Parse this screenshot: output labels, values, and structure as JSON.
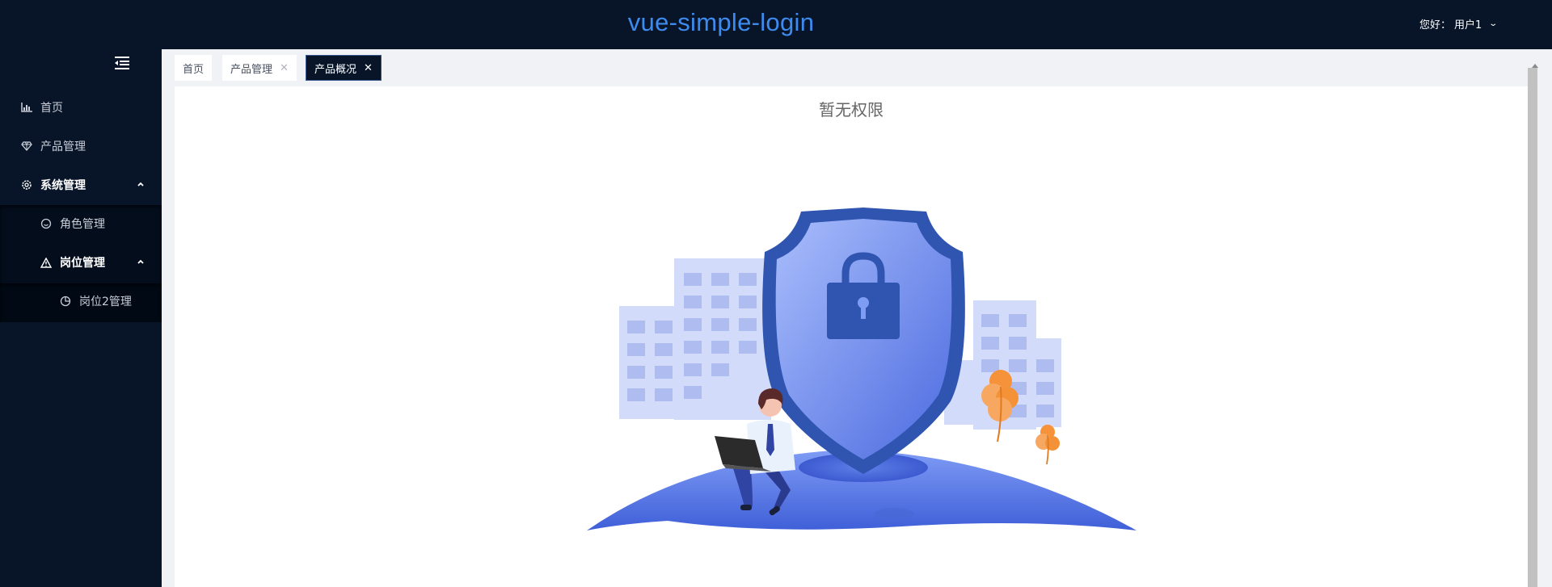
{
  "header": {
    "app_title": "vue-simple-login",
    "user_greeting": "您好：",
    "user_name": "用户1"
  },
  "sidebar": {
    "items": [
      {
        "label": "首页",
        "icon": "chart-icon"
      },
      {
        "label": "产品管理",
        "icon": "diamond-icon"
      },
      {
        "label": "系统管理",
        "icon": "gear-icon",
        "expanded": true
      },
      {
        "label": "角色管理",
        "icon": "smile-icon"
      },
      {
        "label": "岗位管理",
        "icon": "warning-triangle-icon",
        "expanded": true
      },
      {
        "label": "岗位2管理",
        "icon": "pie-chart-icon"
      }
    ]
  },
  "tabs": [
    {
      "label": "首页",
      "closable": false
    },
    {
      "label": "产品管理",
      "closable": true
    },
    {
      "label": "产品概况",
      "closable": true,
      "active": true
    }
  ],
  "main": {
    "message": "暂无权限"
  },
  "colors": {
    "nav_bg": "#081529",
    "title_blue": "#3d8bef",
    "shield_blue": "#2f55b0",
    "illustration_light": "#cfd8f8",
    "tree_orange": "#f39236"
  }
}
